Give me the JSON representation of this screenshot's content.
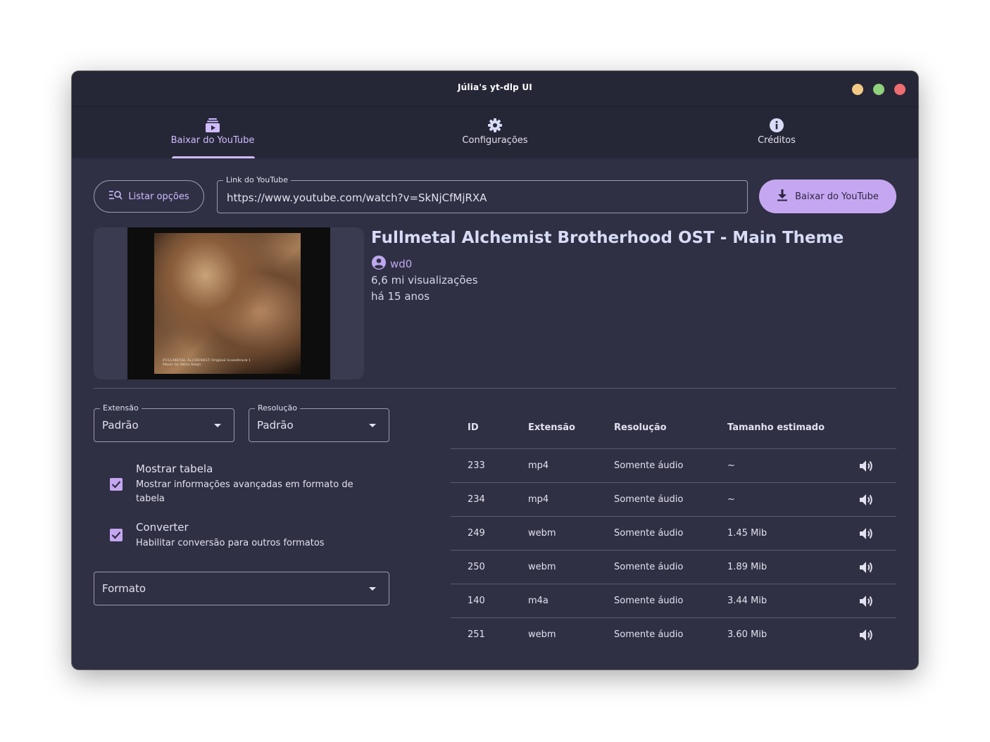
{
  "window": {
    "title": "Júlia's yt-dlp UI"
  },
  "tabs": [
    {
      "label": "Baixar do YouTube",
      "icon": "youtube-subscriptions-icon",
      "active": true
    },
    {
      "label": "Configurações",
      "icon": "gear-icon",
      "active": false
    },
    {
      "label": "Créditos",
      "icon": "info-icon",
      "active": false
    }
  ],
  "toolbar": {
    "list_button": "Listar opções",
    "url_label": "Link do YouTube",
    "url_value": "https://www.youtube.com/watch?v=SkNjCfMjRXA",
    "download_button": "Baixar do YouTube"
  },
  "video": {
    "title": "Fullmetal Alchemist Brotherhood OST - Main Theme",
    "channel": "wd0",
    "views": "6,6 mi visualizações",
    "age": "há 15 anos",
    "thumbnail_caption_1": "FULLMETAL ALCHEMIST Original Soundtrack 1",
    "thumbnail_caption_2": "Music by Akira Senju"
  },
  "filters": {
    "extension_label": "Extensão",
    "extension_value": "Padrão",
    "resolution_label": "Resolução",
    "resolution_value": "Padrão",
    "format_value": "Formato"
  },
  "options": [
    {
      "title": "Mostrar tabela",
      "desc": "Mostrar informações avançadas em formato de tabela",
      "checked": true
    },
    {
      "title": "Converter",
      "desc": "Habilitar conversão para outros formatos",
      "checked": true
    }
  ],
  "table": {
    "headers": [
      "ID",
      "Extensão",
      "Resolução",
      "Tamanho estimado"
    ],
    "rows": [
      [
        "233",
        "mp4",
        "Somente áudio",
        "~"
      ],
      [
        "234",
        "mp4",
        "Somente áudio",
        "~"
      ],
      [
        "249",
        "webm",
        "Somente áudio",
        "1.45 Mib"
      ],
      [
        "250",
        "webm",
        "Somente áudio",
        "1.89 Mib"
      ],
      [
        "140",
        "m4a",
        "Somente áudio",
        "3.44 Mib"
      ],
      [
        "251",
        "webm",
        "Somente áudio",
        "3.60 Mib"
      ]
    ]
  },
  "colors": {
    "accent": "#cfbcff",
    "button_fill": "#c5a7f1",
    "background": "#2f3044",
    "header": "#262736"
  }
}
